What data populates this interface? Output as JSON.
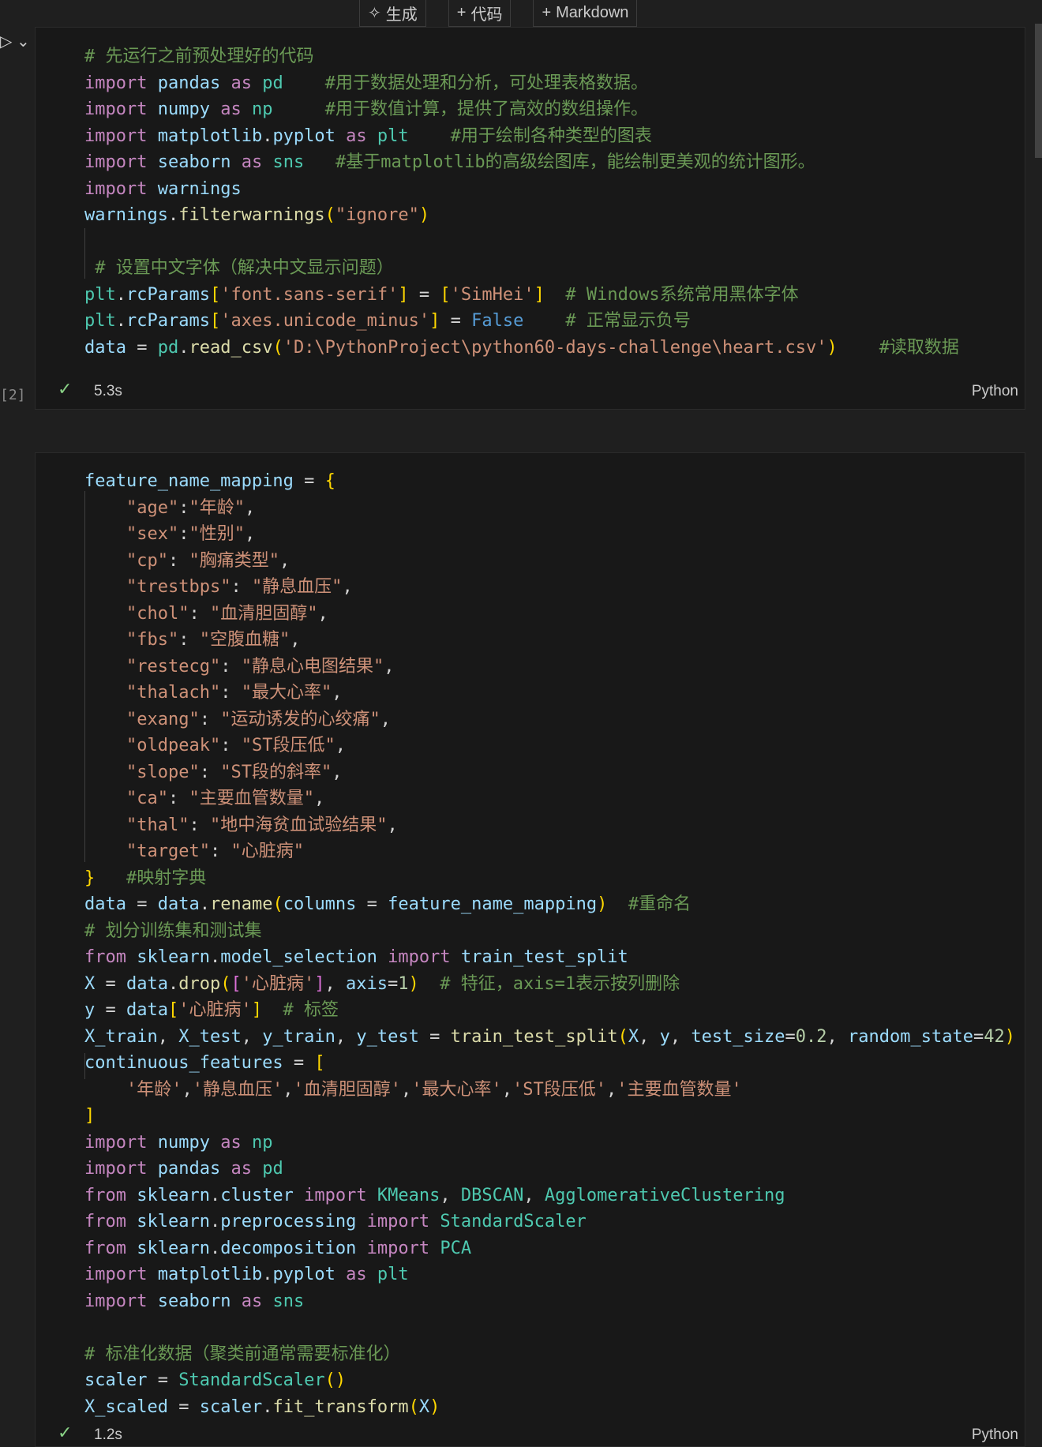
{
  "toolbar": {
    "generate_label": "生成",
    "code_label": "代码",
    "markdown_label": "Markdown"
  },
  "cell1": {
    "exec_count": "[2]",
    "time": "5.3s",
    "language": "Python",
    "lines": [
      "# 先运行之前预处理好的代码",
      "import pandas as pd    #用于数据处理和分析，可处理表格数据。",
      "import numpy as np     #用于数值计算，提供了高效的数组操作。",
      "import matplotlib.pyplot as plt    #用于绘制各种类型的图表",
      "import seaborn as sns   #基于matplotlib的高级绘图库，能绘制更美观的统计图形。",
      "import warnings",
      "warnings.filterwarnings(\"ignore\")",
      "",
      " # 设置中文字体（解决中文显示问题）",
      "plt.rcParams['font.sans-serif'] = ['SimHei']  # Windows系统常用黑体字体",
      "plt.rcParams['axes.unicode_minus'] = False    # 正常显示负号",
      "data = pd.read_csv('D:\\PythonProject\\python60-days-challenge\\heart.csv')    #读取数据"
    ]
  },
  "cell2": {
    "time": "1.2s",
    "language": "Python",
    "lines": [
      "feature_name_mapping = {",
      "    \"age\":\"年龄\",",
      "    \"sex\":\"性别\",",
      "    \"cp\": \"胸痛类型\",",
      "    \"trestbps\": \"静息血压\",",
      "    \"chol\": \"血清胆固醇\",",
      "    \"fbs\": \"空腹血糖\",",
      "    \"restecg\": \"静息心电图结果\",",
      "    \"thalach\": \"最大心率\",",
      "    \"exang\": \"运动诱发的心绞痛\",",
      "    \"oldpeak\": \"ST段压低\",",
      "    \"slope\": \"ST段的斜率\",",
      "    \"ca\": \"主要血管数量\",",
      "    \"thal\": \"地中海贫血试验结果\",",
      "    \"target\": \"心脏病\"",
      "}   #映射字典",
      "data = data.rename(columns = feature_name_mapping)  #重命名",
      "# 划分训练集和测试集",
      "from sklearn.model_selection import train_test_split",
      "X = data.drop(['心脏病'], axis=1)  # 特征，axis=1表示按列删除",
      "y = data['心脏病']  # 标签",
      "X_train, X_test, y_train, y_test = train_test_split(X, y, test_size=0.2, random_state=42)",
      "continuous_features = [",
      "    '年龄','静息血压','血清胆固醇','最大心率','ST段压低','主要血管数量'",
      "]",
      "import numpy as np",
      "import pandas as pd",
      "from sklearn.cluster import KMeans, DBSCAN, AgglomerativeClustering",
      "from sklearn.preprocessing import StandardScaler",
      "from sklearn.decomposition import PCA",
      "import matplotlib.pyplot as plt",
      "import seaborn as sns",
      "",
      "# 标准化数据（聚类前通常需要标准化）",
      "scaler = StandardScaler()",
      "X_scaled = scaler.fit_transform(X)"
    ]
  }
}
